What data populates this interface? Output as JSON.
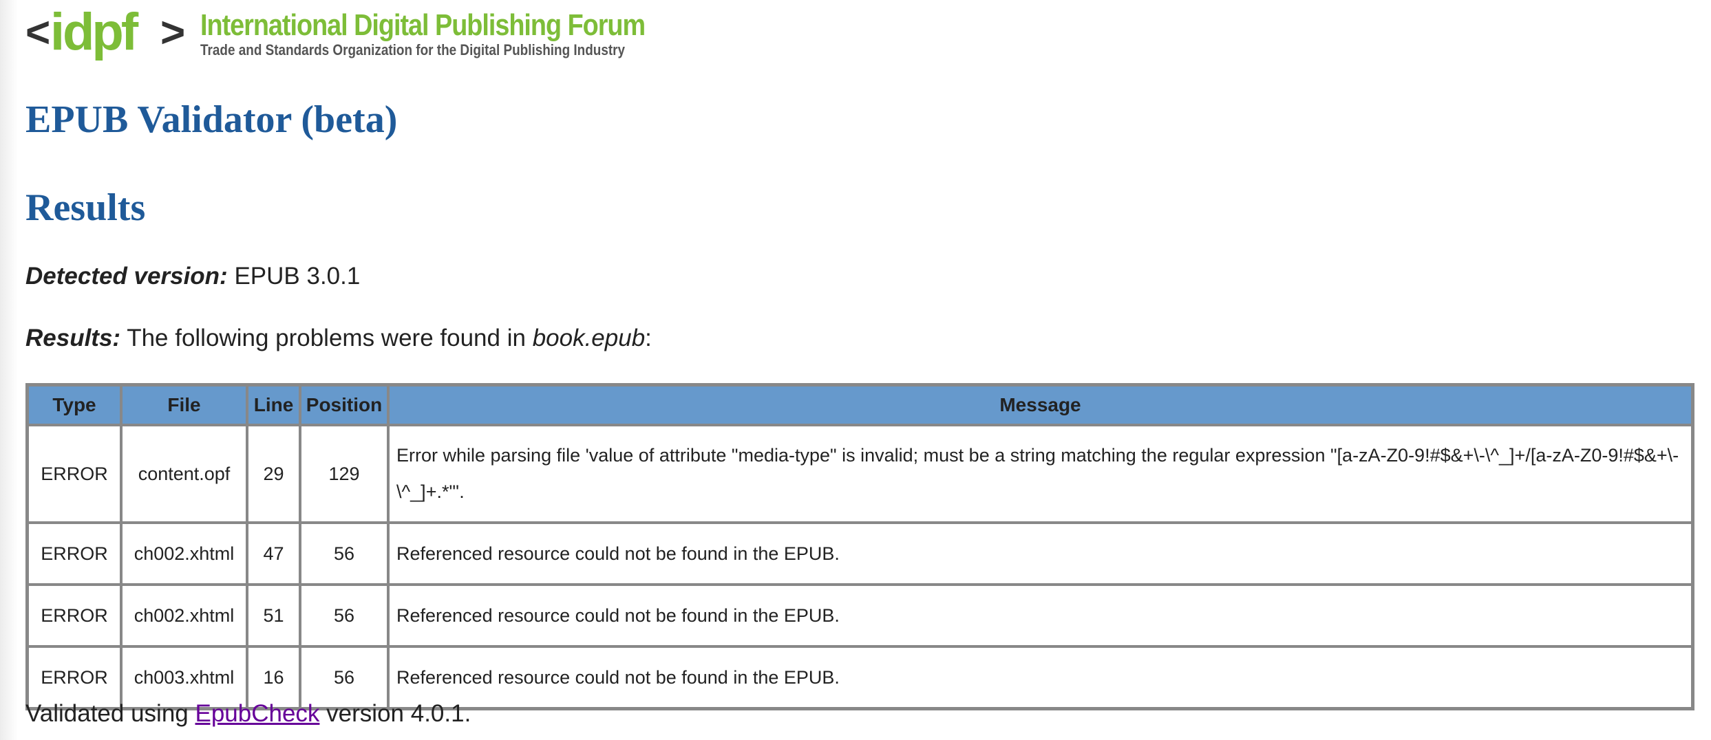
{
  "header": {
    "logo_text": "<idpf>",
    "org_name": "International Digital Publishing Forum",
    "tagline": "Trade and Standards Organization for the Digital Publishing Industry"
  },
  "app_title": "EPUB Validator (beta)",
  "results_heading": "Results",
  "detected_version": {
    "label": "Detected version:",
    "value": "EPUB 3.0.1"
  },
  "summary": {
    "label": "Results:",
    "text": "The following problems were found in",
    "file": "book.epub",
    "suffix": ":"
  },
  "table": {
    "headers": {
      "type": "Type",
      "file": "File",
      "line": "Line",
      "position": "Position",
      "message": "Message"
    },
    "rows": [
      {
        "type": "ERROR",
        "file": "content.opf",
        "line": "29",
        "position": "129",
        "message": "Error while parsing file 'value of attribute \"media-type\" is invalid; must be a string matching the regular expression \"[a-zA-Z0-9!#$&+\\-\\^_]+/[a-zA-Z0-9!#$&+\\-\\^_]+.*\"'."
      },
      {
        "type": "ERROR",
        "file": "ch002.xhtml",
        "line": "47",
        "position": "56",
        "message": "Referenced resource could not be found in the EPUB."
      },
      {
        "type": "ERROR",
        "file": "ch002.xhtml",
        "line": "51",
        "position": "56",
        "message": "Referenced resource could not be found in the EPUB."
      },
      {
        "type": "ERROR",
        "file": "ch003.xhtml",
        "line": "16",
        "position": "56",
        "message": "Referenced resource could not be found in the EPUB."
      }
    ]
  },
  "footer": {
    "prefix": "Validated using",
    "link_text": "EpubCheck",
    "suffix": "version 4.0.1."
  },
  "colors": {
    "heading": "#1f5a99",
    "table_header": "#6699cc",
    "logo_green": "#7dbd38",
    "logo_dark": "#333333",
    "link_visited": "#660099"
  }
}
